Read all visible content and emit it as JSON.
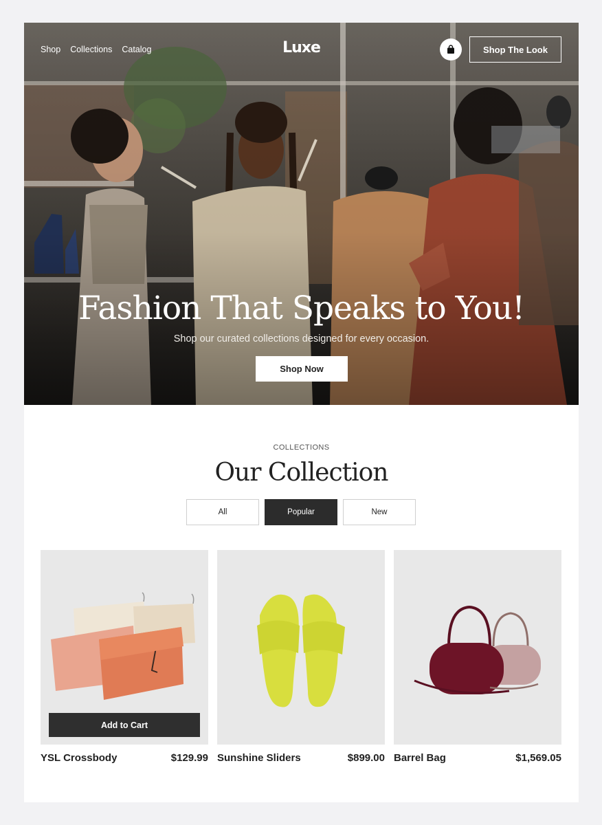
{
  "nav": {
    "links": [
      "Shop",
      "Collections",
      "Catalog"
    ],
    "logo": "Luxe",
    "cart_icon": "shopping-bag-icon",
    "cta_label": "Shop The Look"
  },
  "hero": {
    "title": "Fashion That Speaks to You!",
    "subtitle": "Shop our curated collections designed for every occasion.",
    "cta_label": "Shop Now"
  },
  "collection": {
    "eyebrow": "COLLECTIONS",
    "title": "Our Collection",
    "filters": [
      {
        "label": "All",
        "active": false
      },
      {
        "label": "Popular",
        "active": true
      },
      {
        "label": "New",
        "active": false
      }
    ]
  },
  "products": [
    {
      "name": "YSL Crossbody",
      "price": "$129.99",
      "add_to_cart_label": "Add to Cart",
      "image": "clutch-bags"
    },
    {
      "name": "Sunshine Sliders",
      "price": "$899.00",
      "image": "yellow-sliders"
    },
    {
      "name": "Barrel Bag",
      "price": "$1,569.05",
      "image": "barrel-bags"
    }
  ],
  "colors": {
    "page_bg": "#f2f2f4",
    "dark_button": "#2c2c2c",
    "card_bg": "#e8e8e8"
  }
}
